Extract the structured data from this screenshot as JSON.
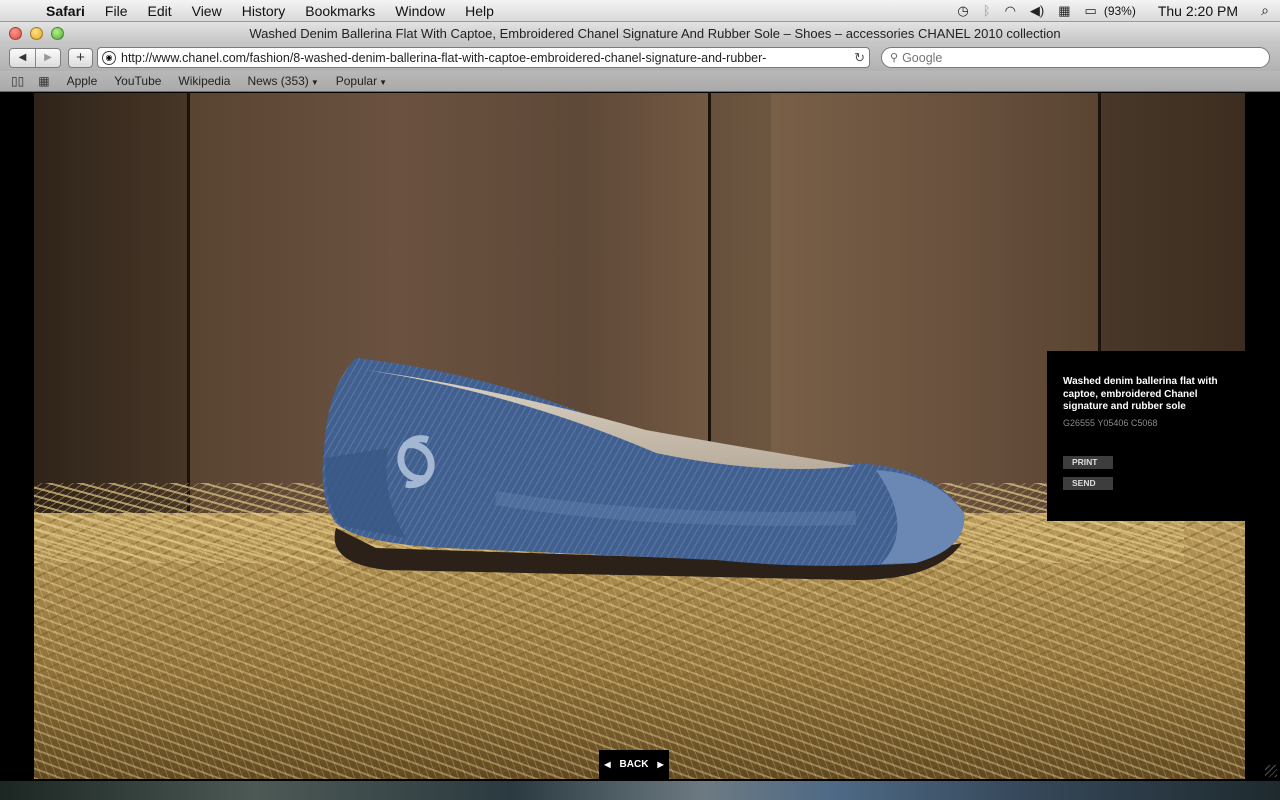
{
  "menubar": {
    "app_name": "Safari",
    "items": [
      "File",
      "Edit",
      "View",
      "History",
      "Bookmarks",
      "Window",
      "Help"
    ],
    "battery": "(93%)",
    "clock": "Thu 2:20 PM"
  },
  "window": {
    "title": "Washed Denim Ballerina Flat With Captoe, Embroidered Chanel Signature And Rubber Sole – Shoes – accessories CHANEL 2010 collection"
  },
  "toolbar": {
    "url": "http://www.chanel.com/fashion/8-washed-denim-ballerina-flat-with-captoe-embroidered-chanel-signature-and-rubber-",
    "search_placeholder": "Google"
  },
  "bookmarks": {
    "items": [
      "Apple",
      "YouTube",
      "Wikipedia",
      "News (353)",
      "Popular"
    ]
  },
  "product": {
    "name": "Washed denim ballerina flat with captoe, embroidered Chanel signature and rubber sole",
    "code": "G26555 Y05406 C5068",
    "print_label": "PRINT",
    "send_label": "SEND"
  },
  "nav": {
    "back_label": "BACK"
  },
  "colors": {
    "panel_bg": "#000000",
    "button_bg": "#3d3d3d",
    "denim": "#3f5f8f"
  }
}
